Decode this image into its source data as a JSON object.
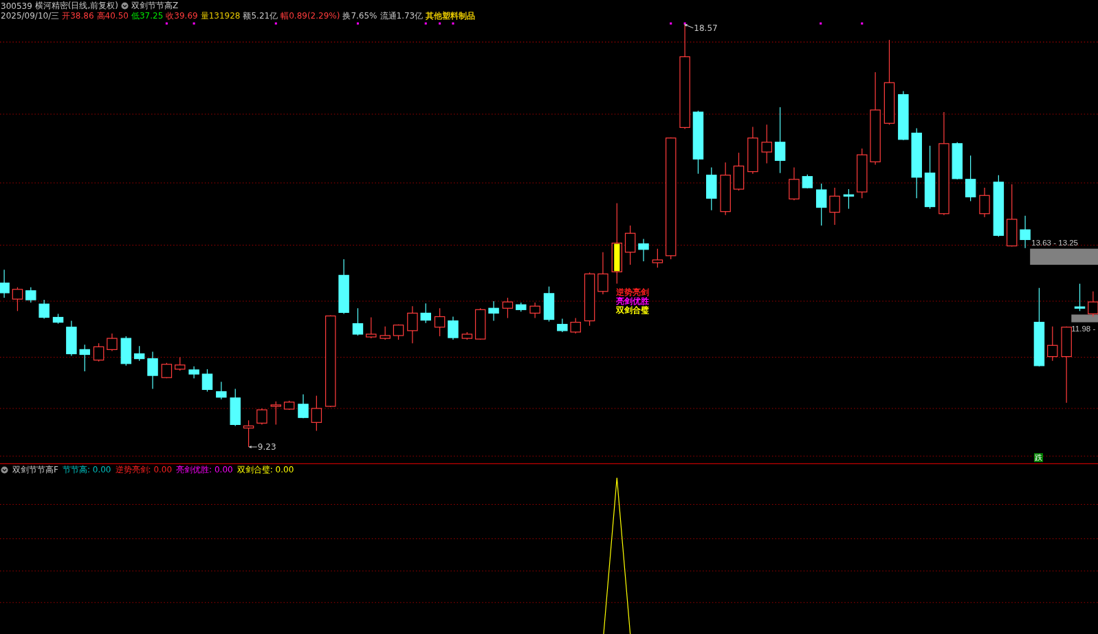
{
  "header": {
    "symbol": "300539",
    "name": "横河精密(日线,前复权)",
    "indicator": "双剑节节高Z"
  },
  "quote": [
    {
      "text": "2025/09/10/三",
      "color": "#c8c8c8"
    },
    {
      "text": "开38.86",
      "color": "#ff3c3c"
    },
    {
      "text": "高40.50",
      "color": "#ff3c3c"
    },
    {
      "text": "低37.25",
      "color": "#00e600"
    },
    {
      "text": "收39.69",
      "color": "#ff3c3c"
    },
    {
      "text": "量131928",
      "color": "#e6c800"
    },
    {
      "text": "额5.21亿",
      "color": "#c8c8c8"
    },
    {
      "text": "幅0.89(2.29%)",
      "color": "#ff3c3c"
    },
    {
      "text": "换7.65%",
      "color": "#c8c8c8"
    },
    {
      "text": "流通1.73亿",
      "color": "#c8c8c8"
    },
    {
      "text": "其他塑料制品",
      "color": "#e6c800"
    }
  ],
  "chart": {
    "high_label": "18.57",
    "low_label": "9.23",
    "zone_labels": [
      "13.63 - 13.25",
      "11.98 -"
    ],
    "signals": [
      {
        "text": "逆势亮剑",
        "color": "#ff2020"
      },
      {
        "text": "亮剑优胜",
        "color": "#ff00ff"
      },
      {
        "text": "双剑合璧",
        "color": "#ffff00"
      }
    ],
    "badge": "跌"
  },
  "indicator_panel": {
    "title": "双剑节节高F",
    "legend": [
      {
        "label": "节节高:",
        "value": "0.00",
        "color": "#00c0c0"
      },
      {
        "label": "逆势亮剑:",
        "value": "0.00",
        "color": "#ff2020"
      },
      {
        "label": "亮剑优胜:",
        "value": "0.00",
        "color": "#ff00ff"
      },
      {
        "label": "双剑合璧:",
        "value": "0.00",
        "color": "#ffff00"
      }
    ]
  }
}
